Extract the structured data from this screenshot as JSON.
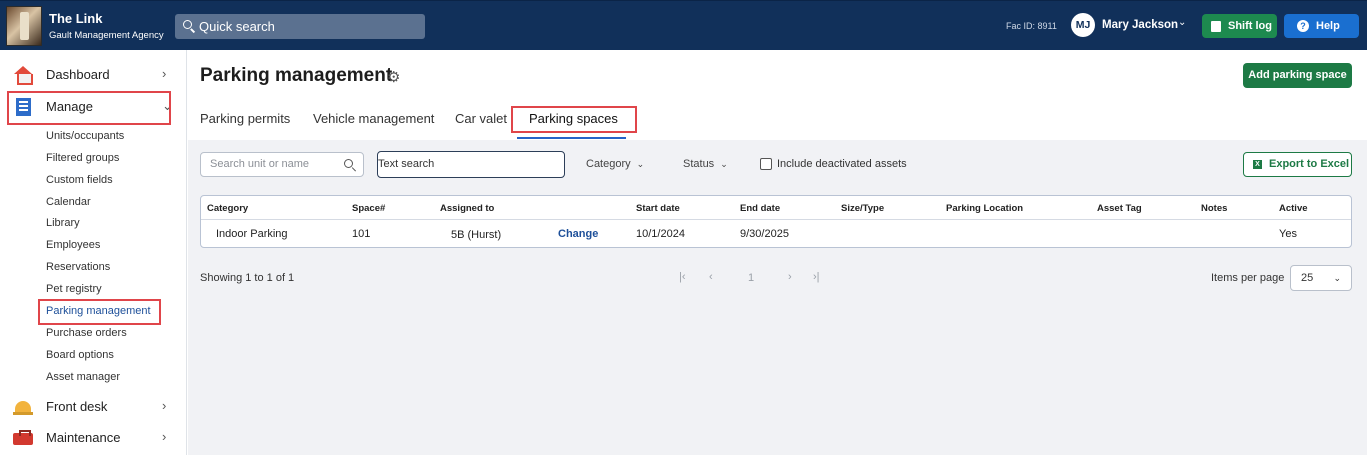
{
  "topbar": {
    "brand_title": "The Link",
    "brand_subtitle": "Gault Management Agency",
    "search_placeholder": "Quick search",
    "fac_id": "Fac ID: 8911",
    "user_initials": "MJ",
    "user_name": "Mary Jackson",
    "shift_log_label": "Shift log",
    "help_label": "Help",
    "colors": {
      "bar": "#11305a",
      "shift_log": "#1d8a4f",
      "help": "#1a6fd0"
    }
  },
  "sidebar": {
    "main_items": [
      {
        "label": "Dashboard",
        "icon": "home-icon"
      },
      {
        "label": "Manage",
        "icon": "building-icon",
        "expanded": true
      },
      {
        "label": "Front desk",
        "icon": "bell-icon"
      },
      {
        "label": "Maintenance",
        "icon": "toolbox-icon"
      }
    ],
    "sub_items": [
      "Units/occupants",
      "Filtered groups",
      "Custom fields",
      "Calendar",
      "Library",
      "Employees",
      "Reservations",
      "Pet registry",
      "Parking management",
      "Purchase orders",
      "Board options",
      "Asset manager"
    ],
    "selected_sub_item": "Parking management"
  },
  "page": {
    "title": "Parking management",
    "add_button": "Add parking space",
    "tabs": [
      "Parking permits",
      "Vehicle management",
      "Car valet",
      "Parking spaces"
    ],
    "active_tab": "Parking spaces"
  },
  "filters": {
    "search_placeholder": "Search unit or name",
    "text_search_placeholder": "Text search",
    "category_label": "Category",
    "status_label": "Status",
    "include_deactivated_label": "Include deactivated assets",
    "include_deactivated_checked": false,
    "export_label": "Export to Excel"
  },
  "table": {
    "columns": [
      "Category",
      "Space#",
      "Assigned to",
      "",
      "Start date",
      "End date",
      "Size/Type",
      "Parking Location",
      "Asset Tag",
      "Notes",
      "Active"
    ],
    "rows": [
      {
        "category": "Indoor Parking",
        "space": "101",
        "assigned_to": "5B (Hurst)",
        "action": "Change",
        "start_date": "10/1/2024",
        "end_date": "9/30/2025",
        "size_type": "",
        "parking_location": "",
        "asset_tag": "",
        "notes": "",
        "active": "Yes"
      }
    ]
  },
  "pagination": {
    "summary": "Showing 1 to 1 of 1",
    "current_page": "1",
    "items_per_page_label": "Items per page",
    "items_per_page": "25"
  }
}
